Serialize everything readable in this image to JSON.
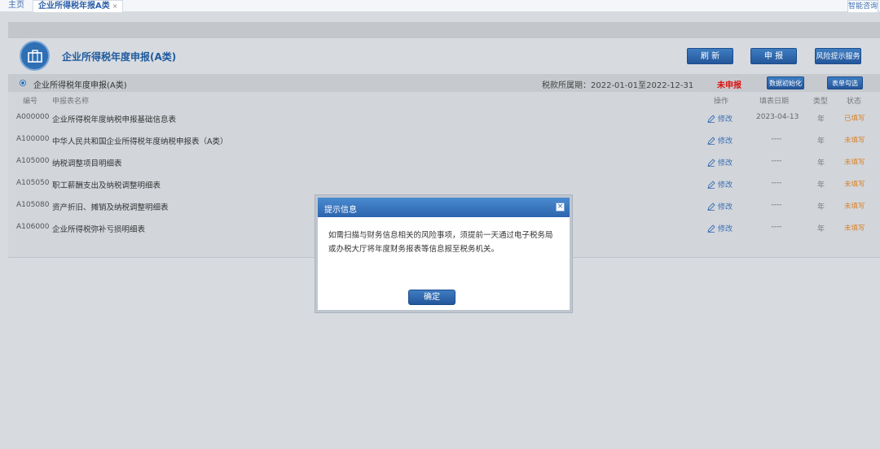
{
  "tabs": {
    "home": "主页",
    "active": "企业所得税年报A类",
    "close": "×",
    "smart": "智能咨询"
  },
  "header": {
    "title": "企业所得税年度申报(A类)",
    "refresh": "刷 新",
    "report": "申 报",
    "risk": "风险提示服务"
  },
  "subheader": {
    "label": "企业所得税年度申报(A类)",
    "period": "税款所属期：2022-01-01至2022-12-31",
    "status": "未申报",
    "init_btn": "数据初始化",
    "check_btn": "表单勾选"
  },
  "table": {
    "headers": {
      "code": "编号",
      "name": "申报表名称",
      "op": "操作",
      "date": "填表日期",
      "type": "类型",
      "status": "状态"
    },
    "rows": [
      {
        "code": "A000000",
        "name": "企业所得税年度纳税申报基础信息表",
        "op": "修改",
        "date": "2023-04-13",
        "type": "年",
        "status": "已填写"
      },
      {
        "code": "A100000",
        "name": "中华人民共和国企业所得税年度纳税申报表（A类）",
        "op": "修改",
        "date": "----",
        "type": "年",
        "status": "未填写"
      },
      {
        "code": "A105000",
        "name": "纳税调整项目明细表",
        "op": "修改",
        "date": "----",
        "type": "年",
        "status": "未填写"
      },
      {
        "code": "A105050",
        "name": "职工薪酬支出及纳税调整明细表",
        "op": "修改",
        "date": "----",
        "type": "年",
        "status": "未填写"
      },
      {
        "code": "A105080",
        "name": "资产折旧、摊销及纳税调整明细表",
        "op": "修改",
        "date": "----",
        "type": "年",
        "status": "未填写"
      },
      {
        "code": "A106000",
        "name": "企业所得税弥补亏损明细表",
        "op": "修改",
        "date": "----",
        "type": "年",
        "status": "未填写"
      }
    ]
  },
  "modal": {
    "title": "提示信息",
    "close": "×",
    "line1": "如需扫描与财务信息相关的风险事项，须提前一天通过电子税务局",
    "line2": "或办税大厅将年度财务报表等信息报至税务机关。",
    "ok": "确定"
  },
  "colors": {
    "accent": "#2f6fb4",
    "danger": "#dd1111",
    "status_orange": "#d9822b"
  },
  "icons": [
    "briefcase-icon",
    "pencil-icon",
    "close-icon",
    "radio-icon"
  ]
}
